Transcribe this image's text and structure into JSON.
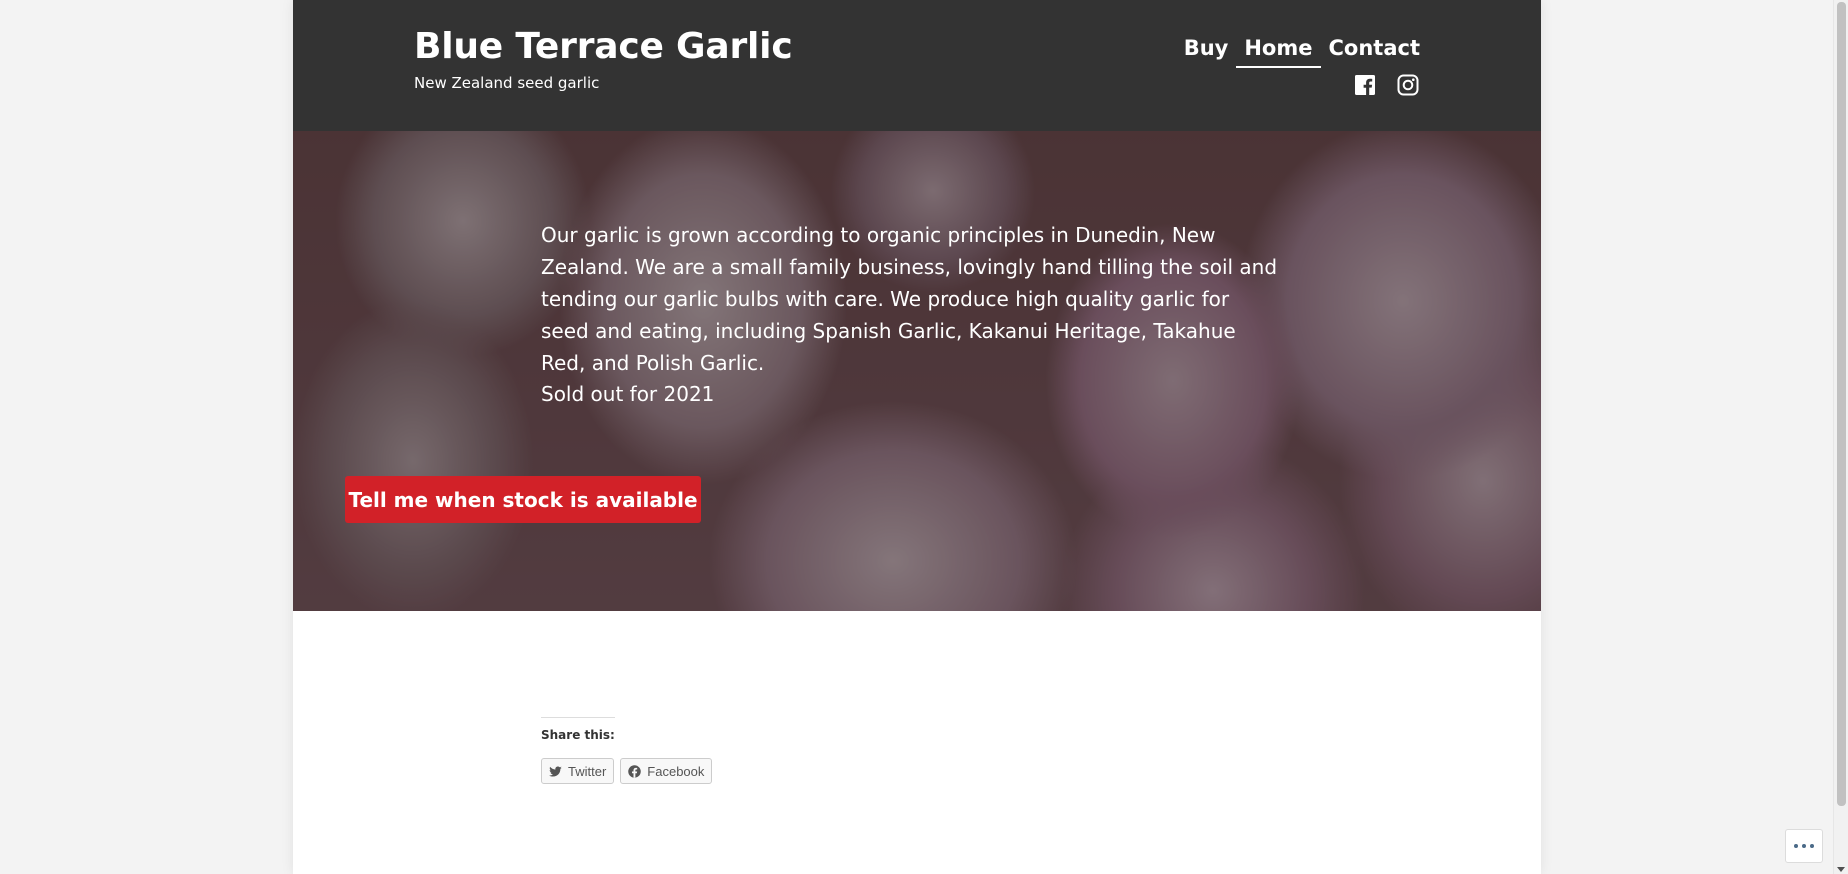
{
  "site": {
    "title": "Blue Terrace Garlic",
    "tagline": "New Zealand seed garlic"
  },
  "nav": {
    "items": [
      {
        "label": "Buy",
        "current": false
      },
      {
        "label": "Home",
        "current": true
      },
      {
        "label": "Contact",
        "current": false
      }
    ]
  },
  "social": {
    "icons": [
      "facebook-icon",
      "instagram-icon"
    ]
  },
  "hero": {
    "text": "Our garlic is grown according to organic principles in Dunedin, New Zealand. We are a small family business, lovingly hand tilling the soil and tending our garlic bulbs with care. We produce high quality garlic for seed and eating, including Spanish Garlic, Kakanui Heritage, Takahue Red, and Polish Garlic.",
    "status": "Sold out for 2021",
    "cta_label": "Tell me when stock is available"
  },
  "share": {
    "heading": "Share this:",
    "buttons": [
      {
        "label": "Twitter",
        "icon": "twitter-icon"
      },
      {
        "label": "Facebook",
        "icon": "facebook-icon"
      }
    ]
  },
  "colors": {
    "header_bg": "#333333",
    "cta_bg": "#d22128",
    "page_bg": "#f3f3f3"
  }
}
